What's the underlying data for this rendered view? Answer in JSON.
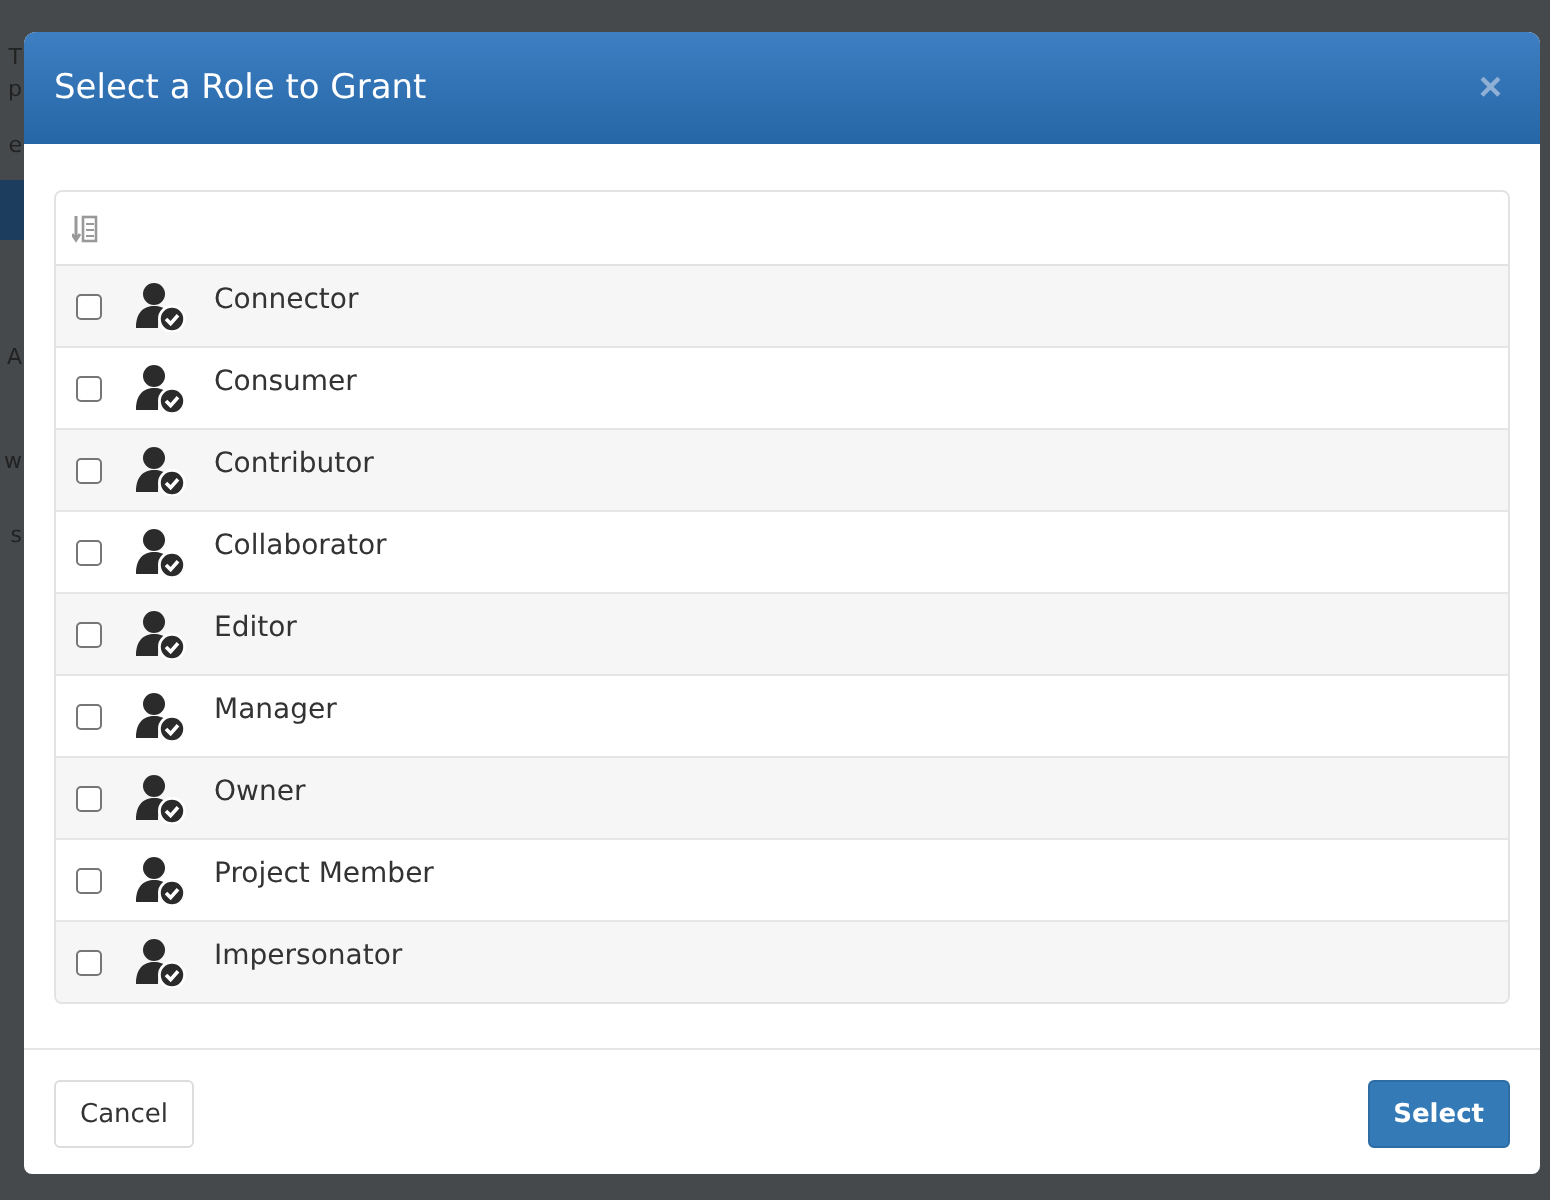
{
  "background_fragments": {
    "left": [
      "T",
      "p",
      "e",
      "A",
      "w",
      "s"
    ]
  },
  "dialog": {
    "title": "Select a Role to Grant",
    "close": "×"
  },
  "roles": [
    {
      "name": "Connector",
      "checked": false
    },
    {
      "name": "Consumer",
      "checked": false
    },
    {
      "name": "Contributor",
      "checked": false
    },
    {
      "name": "Collaborator",
      "checked": false
    },
    {
      "name": "Editor",
      "checked": false
    },
    {
      "name": "Manager",
      "checked": false
    },
    {
      "name": "Owner",
      "checked": false
    },
    {
      "name": "Project Member",
      "checked": false
    },
    {
      "name": "Impersonator",
      "checked": false
    }
  ],
  "buttons": {
    "cancel": "Cancel",
    "select": "Select"
  }
}
